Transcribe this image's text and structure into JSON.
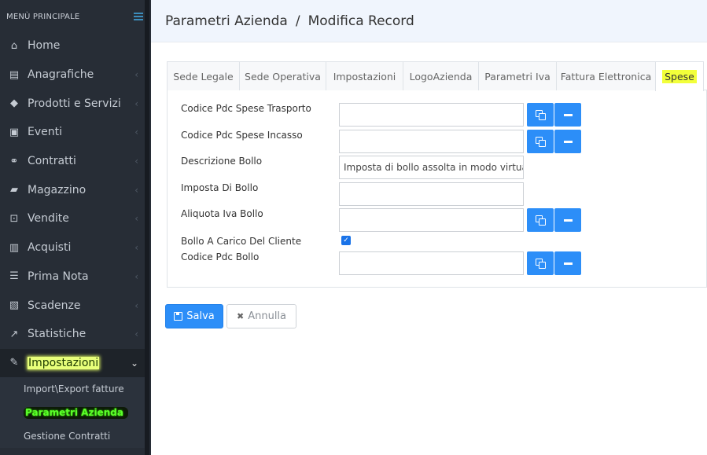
{
  "sidebar": {
    "title": "MENÙ PRINCIPALE",
    "items": [
      {
        "label": "Home",
        "icon": "home-icon",
        "glyph": "⌂"
      },
      {
        "label": "Anagrafiche",
        "icon": "id-card-icon",
        "glyph": "▤"
      },
      {
        "label": "Prodotti e Servizi",
        "icon": "tag-icon",
        "glyph": "◆"
      },
      {
        "label": "Eventi",
        "icon": "calendar-check-icon",
        "glyph": "▣"
      },
      {
        "label": "Contratti",
        "icon": "handshake-icon",
        "glyph": "⚭"
      },
      {
        "label": "Magazzino",
        "icon": "truck-icon",
        "glyph": "▰"
      },
      {
        "label": "Vendite",
        "icon": "basket-icon",
        "glyph": "⊡"
      },
      {
        "label": "Acquisti",
        "icon": "barcode-icon",
        "glyph": "▥"
      },
      {
        "label": "Prima Nota",
        "icon": "list-icon",
        "glyph": "☰"
      },
      {
        "label": "Scadenze",
        "icon": "money-icon",
        "glyph": "▧"
      },
      {
        "label": "Statistiche",
        "icon": "line-chart-icon",
        "glyph": "↗"
      },
      {
        "label": "Impostazioni",
        "icon": "wrench-icon",
        "glyph": "✎"
      }
    ],
    "submenu": [
      {
        "label": "Import\\Export fatture"
      },
      {
        "label": "Parametri Azienda"
      },
      {
        "label": "Gestione Contratti"
      }
    ]
  },
  "header": {
    "crumb1": "Parametri Azienda",
    "sep": "/",
    "crumb2": "Modifica Record"
  },
  "tabs": [
    {
      "label": "Sede Legale"
    },
    {
      "label": "Sede Operativa"
    },
    {
      "label": "Impostazioni"
    },
    {
      "label": "LogoAzienda"
    },
    {
      "label": "Parametri Iva"
    },
    {
      "label": "Fattura Elettronica"
    },
    {
      "label": "Spese"
    }
  ],
  "form": {
    "fields": [
      {
        "label": "Codice Pdc Spese Trasporto",
        "value": ""
      },
      {
        "label": "Codice Pdc Spese Incasso",
        "value": ""
      },
      {
        "label": "Descrizione Bollo",
        "value": "Imposta di bollo assolta in modo virtuale"
      },
      {
        "label": "Imposta Di Bollo",
        "value": ""
      },
      {
        "label": "Aliquota Iva Bollo",
        "value": ""
      },
      {
        "label": "Bollo A Carico Del Cliente",
        "checked": true
      },
      {
        "label": "Codice Pdc Bollo",
        "value": ""
      }
    ]
  },
  "actions": {
    "save": "Salva",
    "cancel": "Annulla"
  },
  "colors": {
    "sidebar_bg": "#272d36",
    "accent": "#2c8ef8",
    "highlight": "#f2ff3a"
  }
}
